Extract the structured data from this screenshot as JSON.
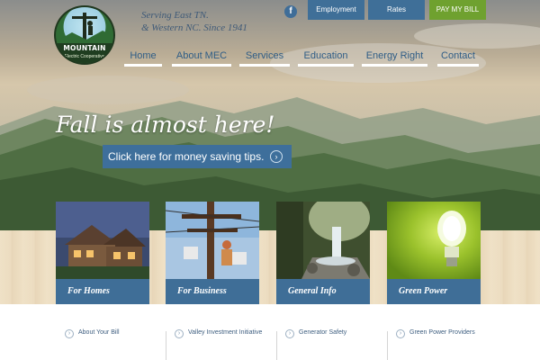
{
  "header": {
    "logo": {
      "title": "MOUNTAIN",
      "subtitle": "Electric Cooperative"
    },
    "tagline": {
      "line1": "Serving East TN.",
      "line2": "& Western NC. Since 1941"
    },
    "social": {
      "facebook_icon": "f"
    },
    "top_buttons": {
      "employment": "Employment",
      "rates": "Rates",
      "pay_bill": "PAY MY BILL"
    },
    "nav": {
      "home": "Home",
      "about": "About MEC",
      "services": "Services",
      "education": "Education",
      "energy_right": "Energy Right",
      "contact": "Contact"
    }
  },
  "hero": {
    "headline": "Fall is almost here!",
    "cta_label": "Click here for money saving tips.",
    "cta_arrow": "›"
  },
  "tiles": [
    {
      "label": "For Homes"
    },
    {
      "label": "For Business"
    },
    {
      "label": "General Info"
    },
    {
      "label": "Green Power"
    }
  ],
  "links": {
    "col1": [
      "About Your Bill"
    ],
    "col2": [
      "Valley Investment Initiative"
    ],
    "col3": [
      "Generator Safety"
    ],
    "col4": [
      "Green Power Providers"
    ]
  },
  "chevron": "›",
  "colors": {
    "brand_blue": "#3f6f98",
    "pay_green": "#6fa12f",
    "nav_text": "#2f5d86"
  }
}
